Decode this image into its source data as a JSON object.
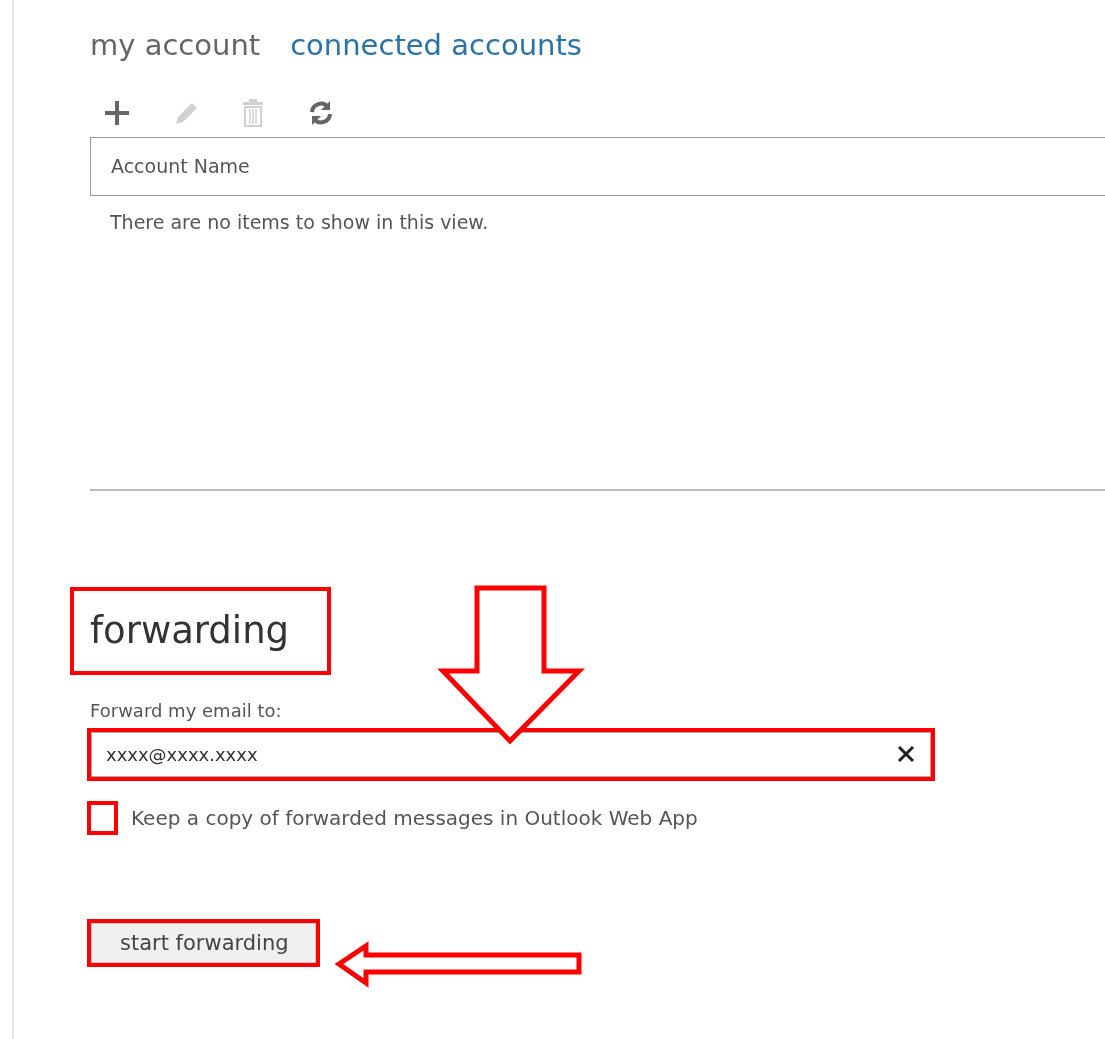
{
  "tabs": [
    {
      "label": "my account",
      "selected": false
    },
    {
      "label": "connected accounts",
      "selected": true
    }
  ],
  "toolbar": [
    {
      "kind": "add",
      "disabled": false
    },
    {
      "kind": "edit",
      "disabled": true
    },
    {
      "kind": "delete",
      "disabled": true
    },
    {
      "kind": "refresh",
      "disabled": false
    }
  ],
  "table": {
    "columns": [
      "Account Name"
    ],
    "empty_message": "There are no items to show in this view."
  },
  "forwarding": {
    "heading": "forwarding",
    "heading_highlighted": true,
    "field_label": "Forward my email to:",
    "value": "xxxx@xxxx.xxxx",
    "field_highlighted": true,
    "keep_copy": {
      "label": "Keep a copy of forwarded messages in Outlook Web App",
      "checked": false,
      "highlighted": true
    },
    "button": {
      "label": "start forwarding",
      "highlighted": true
    }
  }
}
